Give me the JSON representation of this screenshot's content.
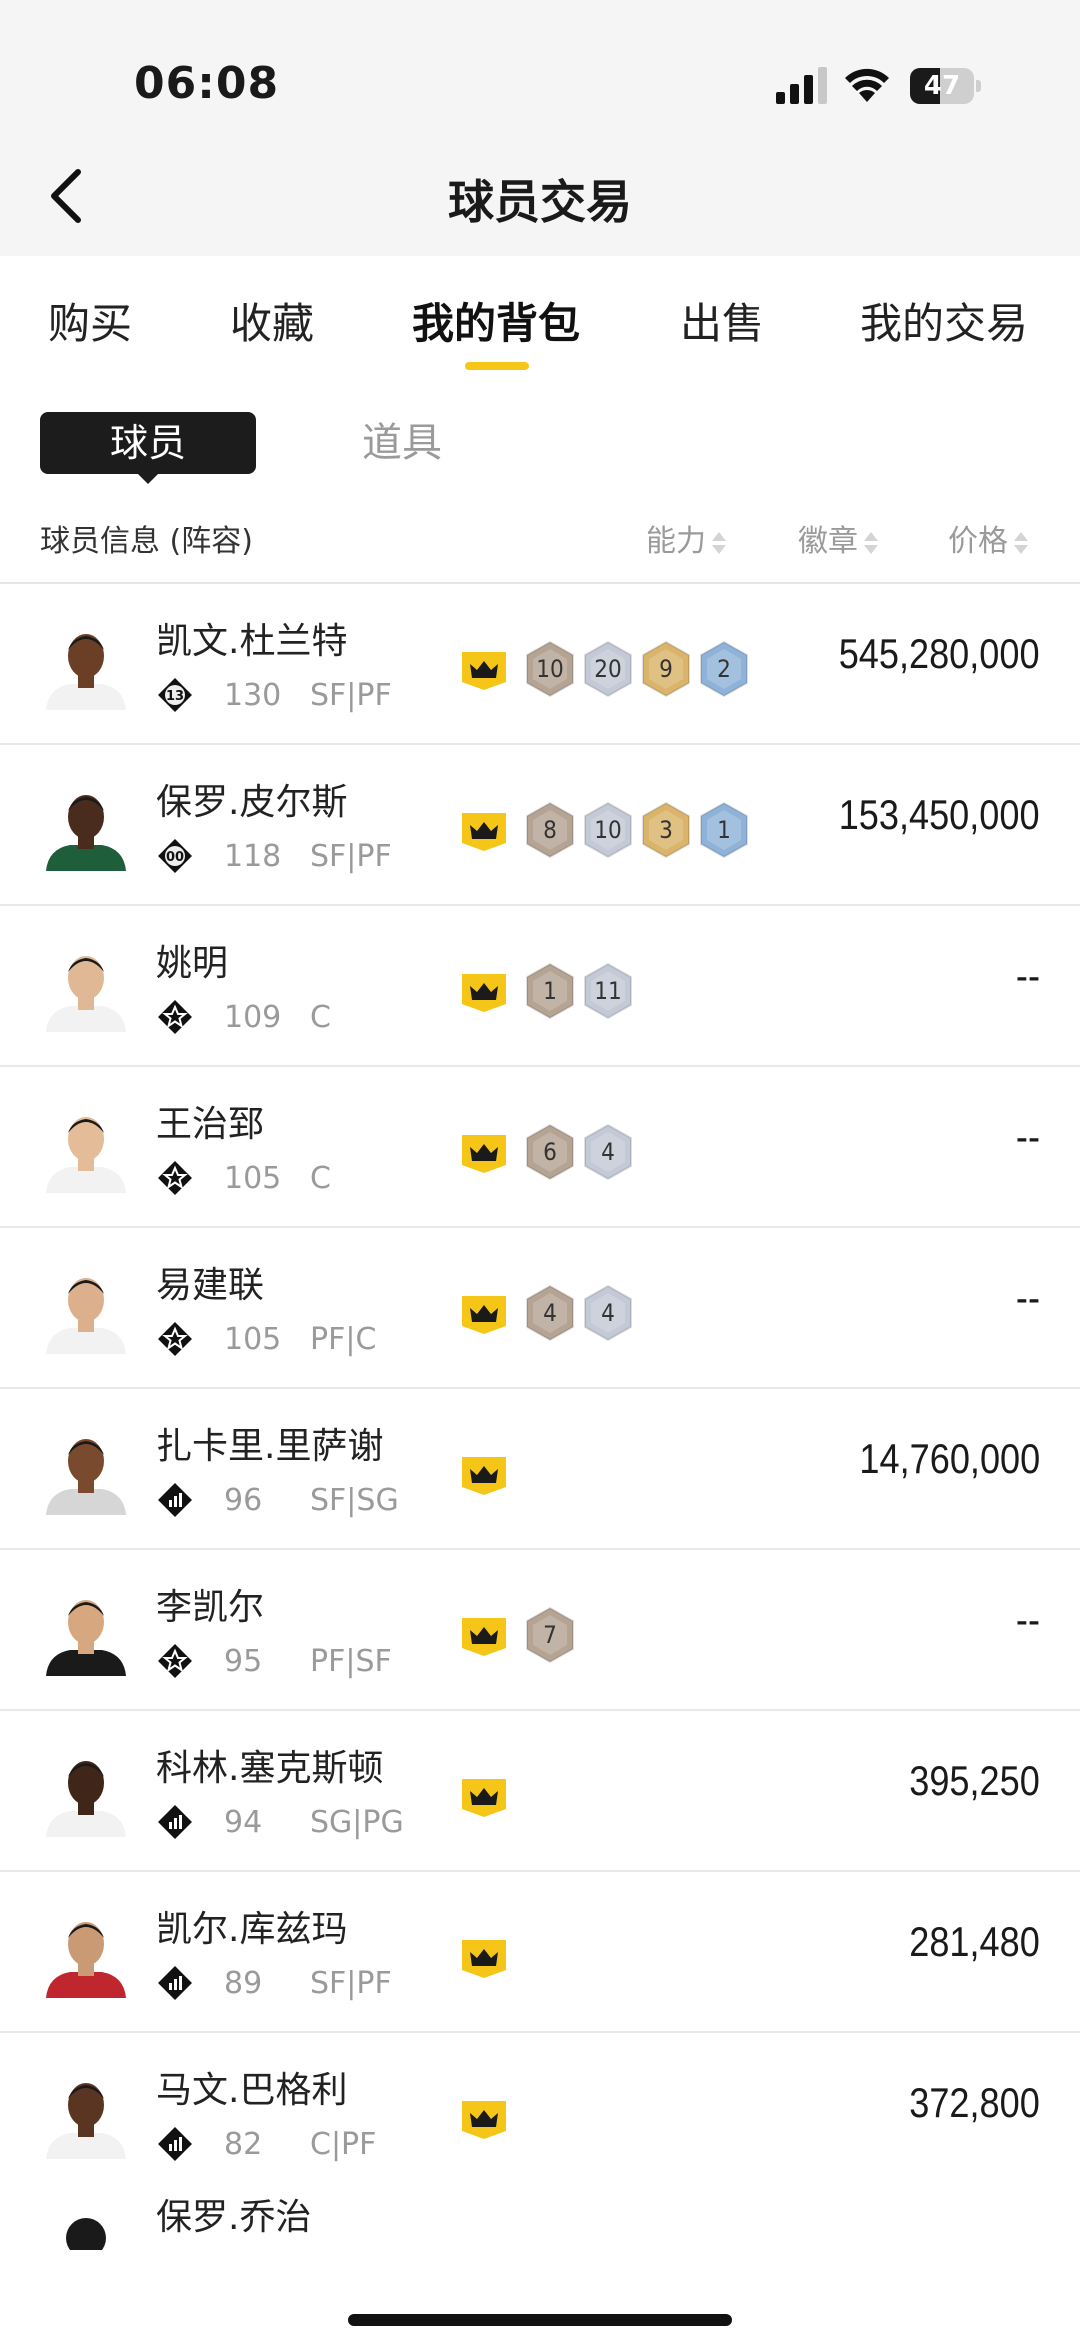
{
  "status_bar": {
    "time": "06:08",
    "battery_percent": "47",
    "battery_level": 0.47
  },
  "nav": {
    "title": "球员交易"
  },
  "tabs": [
    {
      "label": "购买"
    },
    {
      "label": "收藏"
    },
    {
      "label": "我的背包"
    },
    {
      "label": "出售"
    },
    {
      "label": "我的交易"
    }
  ],
  "active_tab": "我的背包",
  "subtabs": {
    "player": "球员",
    "item": "道具"
  },
  "table_header": {
    "info": "球员信息 (阵容)",
    "ability": "能力",
    "badge": "徽章",
    "price": "价格"
  },
  "colors": {
    "accent": "#f5c518",
    "badge_bronze": "#b5a394",
    "badge_silver": "#c3c9d6",
    "badge_gold": "#d9b46a",
    "badge_hof": "#8fb2d8"
  },
  "players": [
    {
      "name": "凯文.杜兰特",
      "tier_icon": "tier-13-icon",
      "tier_label": "13",
      "overall": "130",
      "position": "SF|PF",
      "badges": [
        {
          "type": "bronze",
          "count": "10"
        },
        {
          "type": "silver",
          "count": "20"
        },
        {
          "type": "gold",
          "count": "9"
        },
        {
          "type": "hof",
          "count": "2"
        }
      ],
      "price": "545,280,000"
    },
    {
      "name": "保罗.皮尔斯",
      "tier_icon": "tier-00-icon",
      "tier_label": "00",
      "overall": "118",
      "position": "SF|PF",
      "badges": [
        {
          "type": "bronze",
          "count": "8"
        },
        {
          "type": "silver",
          "count": "10"
        },
        {
          "type": "gold",
          "count": "3"
        },
        {
          "type": "hof",
          "count": "1"
        }
      ],
      "price": "153,450,000"
    },
    {
      "name": "姚明",
      "tier_icon": "star-tier-icon",
      "tier_label": "",
      "overall": "109",
      "position": "C",
      "badges": [
        {
          "type": "bronze",
          "count": "1"
        },
        {
          "type": "silver",
          "count": "11"
        }
      ],
      "price": "--"
    },
    {
      "name": "王治郅",
      "tier_icon": "star-tier-icon",
      "tier_label": "",
      "overall": "105",
      "position": "C",
      "badges": [
        {
          "type": "bronze",
          "count": "6"
        },
        {
          "type": "silver",
          "count": "4"
        }
      ],
      "price": "--"
    },
    {
      "name": "易建联",
      "tier_icon": "star-tier-icon",
      "tier_label": "",
      "overall": "105",
      "position": "PF|C",
      "badges": [
        {
          "type": "bronze",
          "count": "4"
        },
        {
          "type": "silver",
          "count": "4"
        }
      ],
      "price": "--"
    },
    {
      "name": "扎卡里.里萨谢",
      "tier_icon": "bars-tier-icon",
      "tier_label": "",
      "overall": "96",
      "position": "SF|SG",
      "badges": [],
      "price": "14,760,000"
    },
    {
      "name": "李凯尔",
      "tier_icon": "star-tier-icon",
      "tier_label": "",
      "overall": "95",
      "position": "PF|SF",
      "badges": [
        {
          "type": "bronze",
          "count": "7"
        }
      ],
      "price": "--"
    },
    {
      "name": "科林.塞克斯顿",
      "tier_icon": "bars-tier-icon",
      "tier_label": "",
      "overall": "94",
      "position": "SG|PG",
      "badges": [],
      "price": "395,250"
    },
    {
      "name": "凯尔.库兹玛",
      "tier_icon": "bars-tier-icon",
      "tier_label": "",
      "overall": "89",
      "position": "SF|PF",
      "badges": [],
      "price": "281,480"
    },
    {
      "name": "马文.巴格利",
      "tier_icon": "bars-tier-icon",
      "tier_label": "",
      "overall": "82",
      "position": "C|PF",
      "badges": [],
      "price": "372,800"
    }
  ],
  "peek_player": {
    "name": "保罗.乔治"
  }
}
